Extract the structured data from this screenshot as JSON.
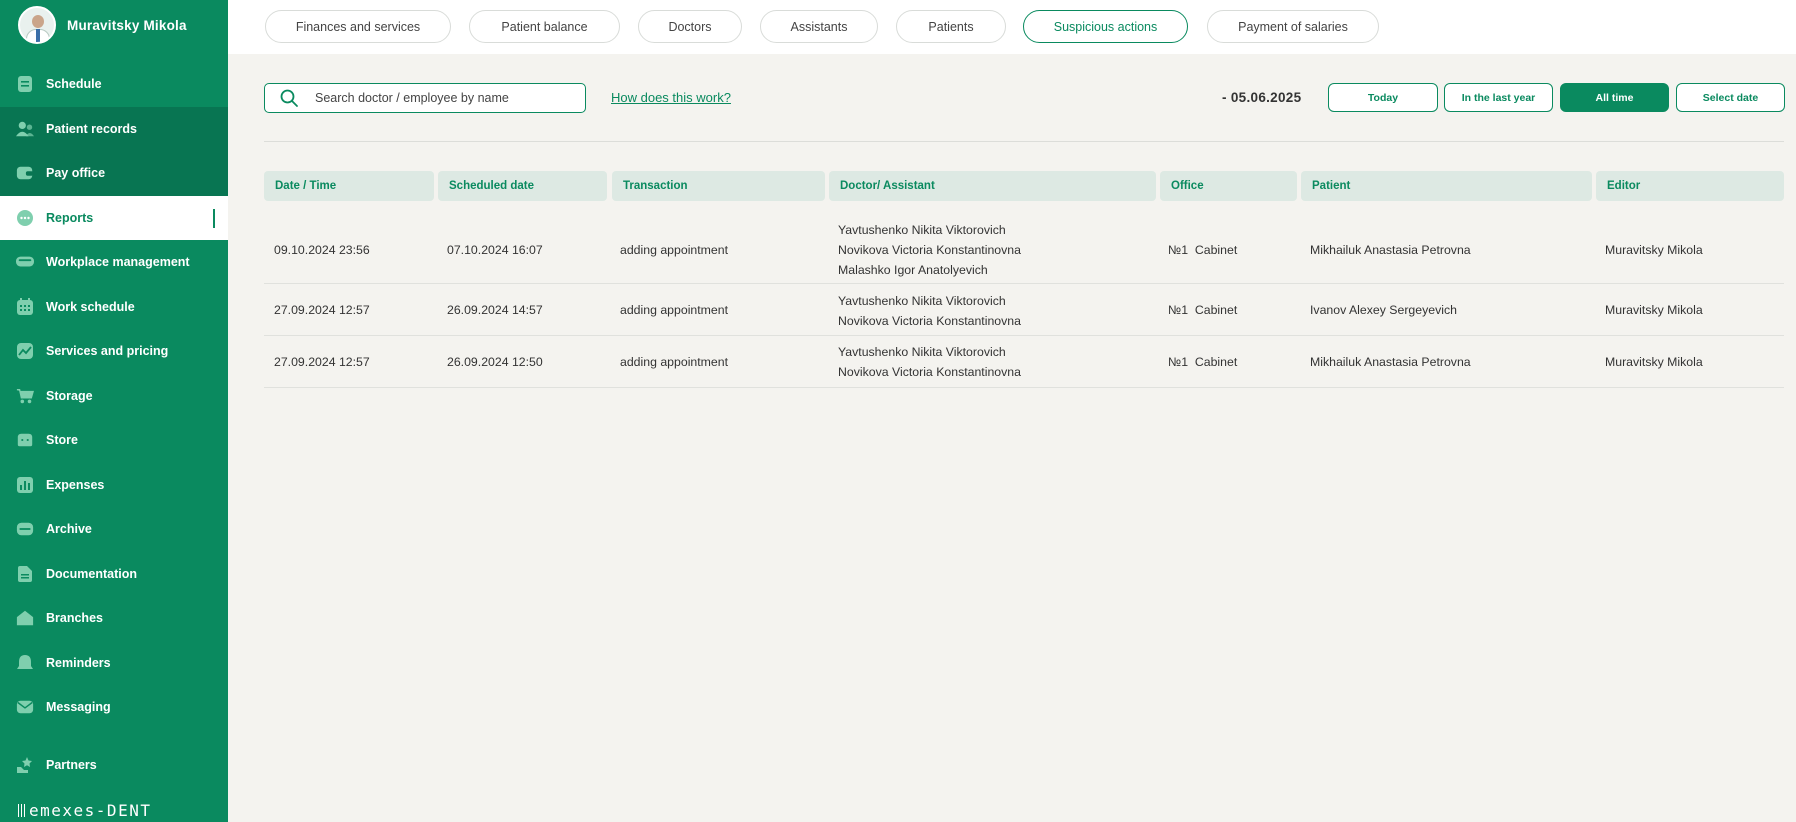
{
  "user": {
    "name": "Muravitsky Mikola"
  },
  "sidebar": {
    "items": [
      {
        "label": "Schedule",
        "icon": "calendar-icon",
        "state": "normal"
      },
      {
        "label": "Patient records",
        "icon": "users-icon",
        "state": "dark"
      },
      {
        "label": "Pay office",
        "icon": "wallet-icon",
        "state": "dark"
      },
      {
        "label": "Reports",
        "icon": "chat-icon",
        "state": "active"
      },
      {
        "label": "Workplace management",
        "icon": "dental-chair-icon",
        "state": "normal"
      },
      {
        "label": "Work schedule",
        "icon": "calendar-grid-icon",
        "state": "normal"
      },
      {
        "label": "Services and pricing",
        "icon": "trend-chart-icon",
        "state": "normal"
      },
      {
        "label": "Storage",
        "icon": "cart-icon",
        "state": "normal"
      },
      {
        "label": "Store",
        "icon": "box-icon",
        "state": "normal"
      },
      {
        "label": "Expenses",
        "icon": "bar-chart-icon",
        "state": "normal"
      },
      {
        "label": "Archive",
        "icon": "archive-icon",
        "state": "normal"
      },
      {
        "label": "Documentation",
        "icon": "document-icon",
        "state": "normal"
      },
      {
        "label": "Branches",
        "icon": "home-icon",
        "state": "normal"
      },
      {
        "label": "Reminders",
        "icon": "bell-icon",
        "state": "normal"
      },
      {
        "label": "Messaging",
        "icon": "mail-icon",
        "state": "normal"
      }
    ],
    "partners": {
      "label": "Partners",
      "icon": "star-hand-icon"
    },
    "brand": "emexes-DENT"
  },
  "tabs": [
    {
      "label": "Finances and services",
      "active": false
    },
    {
      "label": "Patient balance",
      "active": false
    },
    {
      "label": "Doctors",
      "active": false
    },
    {
      "label": "Assistants",
      "active": false
    },
    {
      "label": "Patients",
      "active": false
    },
    {
      "label": "Suspicious actions",
      "active": true
    },
    {
      "label": "Payment of salaries",
      "active": false
    }
  ],
  "search": {
    "placeholder": "Search doctor / employee by name"
  },
  "help_link": "How does this work?",
  "date_range": "- 05.06.2025",
  "filters": [
    {
      "label": "Today",
      "active": false
    },
    {
      "label": "In the last year",
      "active": false
    },
    {
      "label": "All time",
      "active": true
    },
    {
      "label": "Select date",
      "active": false
    }
  ],
  "table": {
    "columns": [
      "Date / Time",
      "Scheduled date",
      "Transaction",
      "Doctor/ Assistant",
      "Office",
      "Patient",
      "Editor"
    ],
    "rows": [
      {
        "datetime": "09.10.2024 23:56",
        "scheduled": "07.10.2024 16:07",
        "transaction": "adding appointment",
        "staff": [
          "Yavtushenko Nikita Viktorovich",
          "Novikova Victoria Konstantinovna",
          "Malashko Igor Anatolyevich"
        ],
        "office": "№1  Cabinet",
        "patient": "Mikhailuk Anastasia Petrovna",
        "editor": "Muravitsky Mikola"
      },
      {
        "datetime": "27.09.2024 12:57",
        "scheduled": "26.09.2024 14:57",
        "transaction": "adding appointment",
        "staff": [
          "Yavtushenko Nikita Viktorovich",
          "Novikova Victoria Konstantinovna"
        ],
        "office": "№1  Cabinet",
        "patient": "Ivanov Alexey Sergeyevich",
        "editor": "Muravitsky Mikola"
      },
      {
        "datetime": "27.09.2024 12:57",
        "scheduled": "26.09.2024 12:50",
        "transaction": "adding appointment",
        "staff": [
          "Yavtushenko Nikita Viktorovich",
          "Novikova Victoria Konstantinovna"
        ],
        "office": "№1  Cabinet",
        "patient": "Mikhailuk Anastasia Petrovna",
        "editor": "Muravitsky Mikola"
      }
    ]
  },
  "colors": {
    "accent": "#0a8a5f",
    "sidebar_dark": "#087552",
    "header_bg": "#dde9e3",
    "page_bg": "#f4f3ef"
  }
}
